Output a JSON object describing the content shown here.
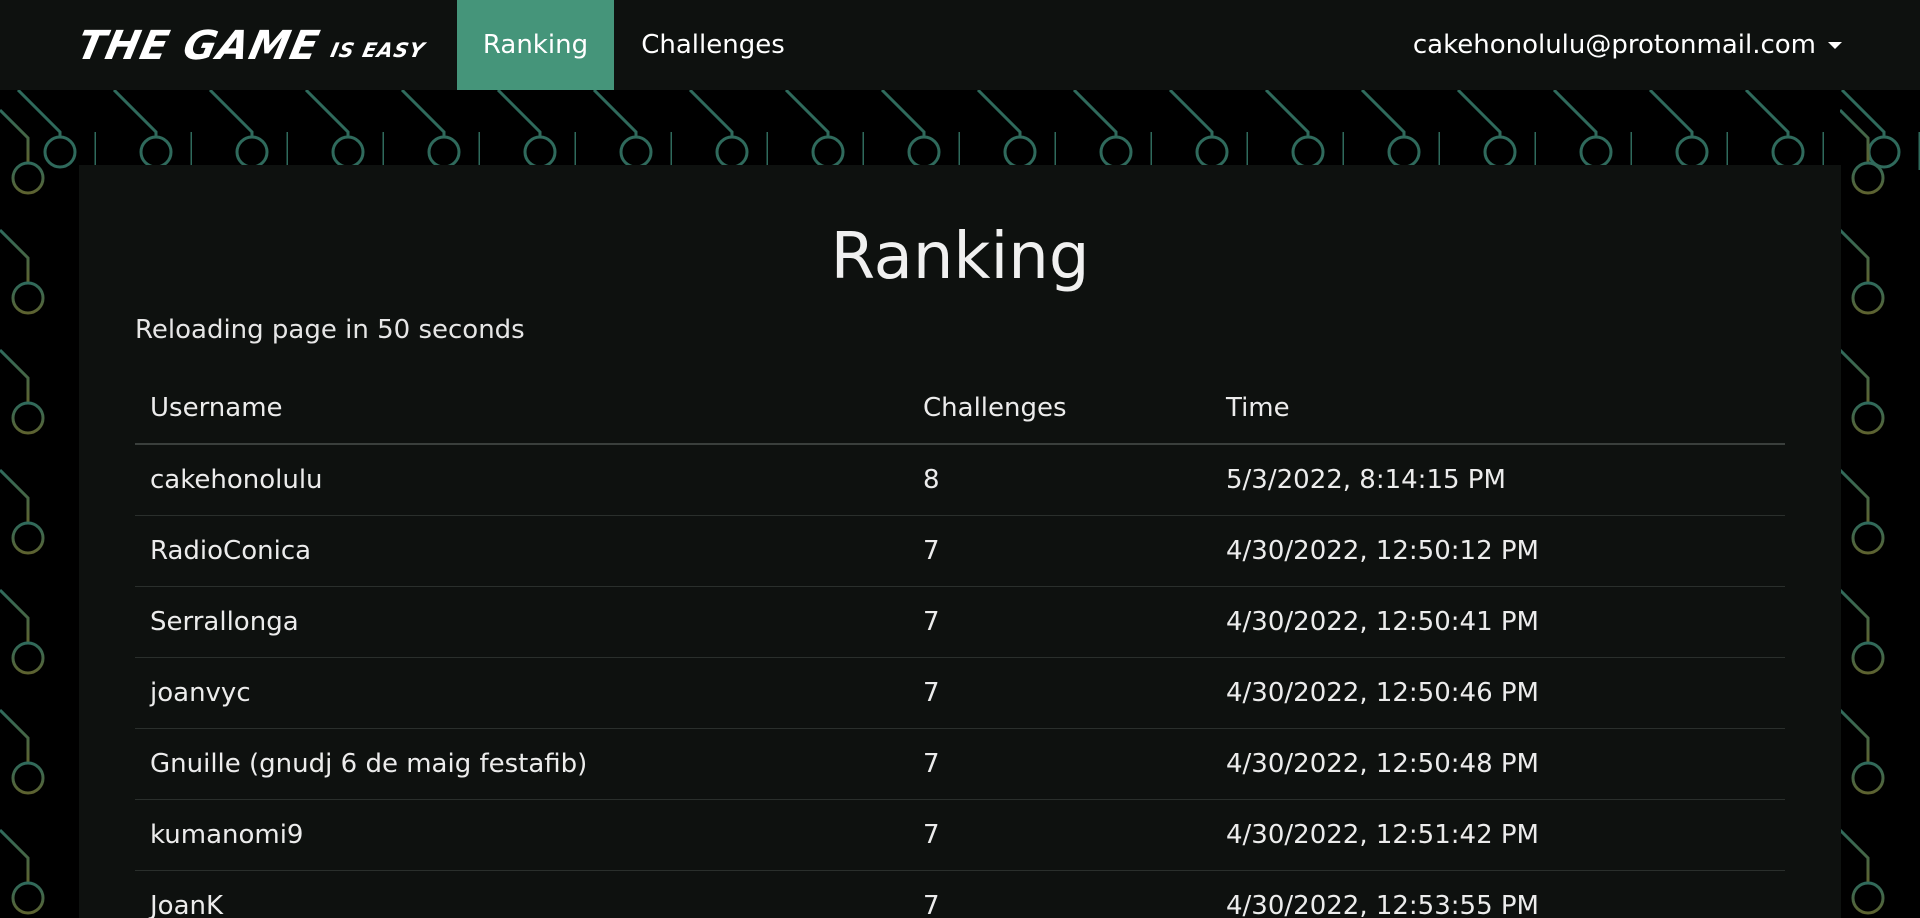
{
  "brand": {
    "main": "THE GAME",
    "sub": "IS EASY"
  },
  "nav": {
    "ranking": "Ranking",
    "challenges": "Challenges",
    "active": "Ranking"
  },
  "user": {
    "email": "cakehonolulu@protonmail.com",
    "icon": "caret-down-icon"
  },
  "colors": {
    "accent": "#45957a",
    "panel": "#0e110f",
    "pattern_top": "#2f6a5c",
    "pattern_bottom": "#5e6330"
  },
  "page": {
    "title": "Ranking",
    "reload": "Reloading page in 50 seconds"
  },
  "table": {
    "headers": [
      "Username",
      "Challenges",
      "Time"
    ],
    "rows": [
      {
        "username": "cakehonolulu",
        "challenges": "8",
        "time": "5/3/2022, 8:14:15 PM"
      },
      {
        "username": "RadioConica",
        "challenges": "7",
        "time": "4/30/2022, 12:50:12 PM"
      },
      {
        "username": "Serrallonga",
        "challenges": "7",
        "time": "4/30/2022, 12:50:41 PM"
      },
      {
        "username": "joanvyc",
        "challenges": "7",
        "time": "4/30/2022, 12:50:46 PM"
      },
      {
        "username": "Gnuille (gnudj 6 de maig festafib)",
        "challenges": "7",
        "time": "4/30/2022, 12:50:48 PM"
      },
      {
        "username": "kumanomi9",
        "challenges": "7",
        "time": "4/30/2022, 12:51:42 PM"
      },
      {
        "username": "JoanK",
        "challenges": "7",
        "time": "4/30/2022, 12:53:55 PM"
      }
    ]
  }
}
